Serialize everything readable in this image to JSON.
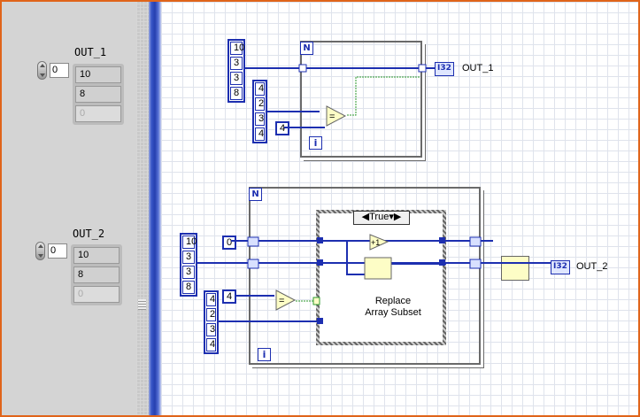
{
  "front_panel": {
    "out1": {
      "label": "OUT_1",
      "index_value": "0",
      "values": [
        "10",
        "8",
        "0"
      ]
    },
    "out2": {
      "label": "OUT_2",
      "index_value": "0",
      "values": [
        "10",
        "8",
        "0"
      ]
    }
  },
  "block_diagram": {
    "top": {
      "loop_count_terminal": "N",
      "iteration_terminal": "i",
      "array_a": [
        "10",
        "3",
        "3",
        "8"
      ],
      "array_b": [
        "4",
        "2",
        "3",
        "4"
      ],
      "scalar_const": "4",
      "compare_symbol": "=",
      "indicator_type": "I32",
      "indicator_label": "OUT_1"
    },
    "bottom": {
      "loop_count_terminal": "N",
      "iteration_terminal": "i",
      "array_a": [
        "10",
        "3",
        "3",
        "8"
      ],
      "array_b": [
        "4",
        "2",
        "3",
        "4"
      ],
      "scalar_const": "4",
      "init_const": "0",
      "compare_symbol": "=",
      "increment_symbol": "+1",
      "case_selector": "True",
      "function_label": "Replace\nArray Subset",
      "indicator_type": "I32",
      "indicator_label": "OUT_2"
    }
  },
  "colors": {
    "wire_int": "#1d2fb0",
    "wire_bool": "#2e9a2e",
    "window_border": "#e0641a"
  }
}
